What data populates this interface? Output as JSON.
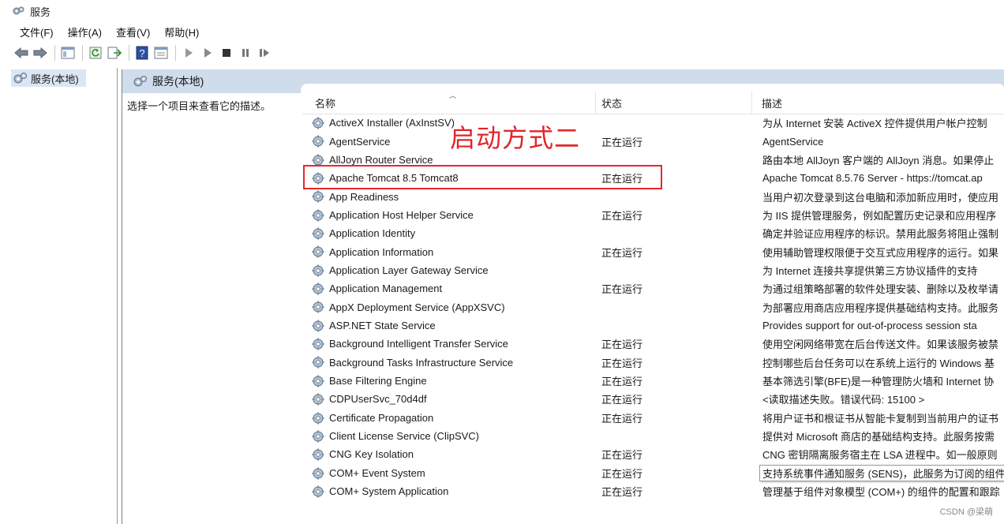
{
  "window": {
    "title": "服务",
    "icon": "services-icon"
  },
  "menu": [
    {
      "label": "文件(F)"
    },
    {
      "label": "操作(A)"
    },
    {
      "label": "查看(V)"
    },
    {
      "label": "帮助(H)"
    }
  ],
  "toolbar": [
    "back-icon",
    "forward-icon",
    "show-hide-tree-icon",
    "refresh-icon",
    "export-list-icon",
    "help-icon",
    "properties-icon",
    "start-service-icon",
    "start-service-alt-icon",
    "stop-service-icon",
    "pause-service-icon",
    "resume-service-icon"
  ],
  "tree": {
    "root_label": "服务(本地)"
  },
  "pane": {
    "header_title": "服务(本地)",
    "select_hint": "选择一个项目来查看它的描述。",
    "columns": {
      "name": "名称",
      "status": "状态",
      "description": "描述"
    }
  },
  "services": [
    {
      "name": "ActiveX Installer (AxInstSV)",
      "status": "",
      "description": "为从 Internet 安装 ActiveX 控件提供用户帐户控制"
    },
    {
      "name": "AgentService",
      "status": "正在运行",
      "description": "AgentService"
    },
    {
      "name": "AllJoyn Router Service",
      "status": "",
      "description": "路由本地 AllJoyn 客户端的 AllJoyn 消息。如果停止"
    },
    {
      "name": "Apache Tomcat 8.5 Tomcat8",
      "status": "正在运行",
      "description": "Apache Tomcat 8.5.76 Server - https://tomcat.ap"
    },
    {
      "name": "App Readiness",
      "status": "",
      "description": "当用户初次登录到这台电脑和添加新应用时，使应用"
    },
    {
      "name": "Application Host Helper Service",
      "status": "正在运行",
      "description": "为 IIS 提供管理服务，例如配置历史记录和应用程序"
    },
    {
      "name": "Application Identity",
      "status": "",
      "description": "确定并验证应用程序的标识。禁用此服务将阻止强制"
    },
    {
      "name": "Application Information",
      "status": "正在运行",
      "description": "使用辅助管理权限便于交互式应用程序的运行。如果"
    },
    {
      "name": "Application Layer Gateway Service",
      "status": "",
      "description": "为 Internet 连接共享提供第三方协议插件的支持"
    },
    {
      "name": "Application Management",
      "status": "正在运行",
      "description": "为通过组策略部署的软件处理安装、删除以及枚举请"
    },
    {
      "name": "AppX Deployment Service (AppXSVC)",
      "status": "",
      "description": "为部署应用商店应用程序提供基础结构支持。此服务"
    },
    {
      "name": "ASP.NET State Service",
      "status": "",
      "description": "Provides support for out-of-process session sta"
    },
    {
      "name": "Background Intelligent Transfer Service",
      "status": "正在运行",
      "description": "使用空闲网络带宽在后台传送文件。如果该服务被禁"
    },
    {
      "name": "Background Tasks Infrastructure Service",
      "status": "正在运行",
      "description": "控制哪些后台任务可以在系统上运行的 Windows 基"
    },
    {
      "name": "Base Filtering Engine",
      "status": "正在运行",
      "description": "基本筛选引擎(BFE)是一种管理防火墙和 Internet 协"
    },
    {
      "name": "CDPUserSvc_70d4df",
      "status": "正在运行",
      "description": "<读取描述失败。错误代码: 15100 >"
    },
    {
      "name": "Certificate Propagation",
      "status": "正在运行",
      "description": "将用户证书和根证书从智能卡复制到当前用户的证书"
    },
    {
      "name": "Client License Service (ClipSVC)",
      "status": "",
      "description": "提供对 Microsoft 商店的基础结构支持。此服务按需"
    },
    {
      "name": "CNG Key Isolation",
      "status": "正在运行",
      "description": "CNG 密钥隔离服务宿主在 LSA 进程中。如一般原则"
    },
    {
      "name": "COM+ Event System",
      "status": "正在运行",
      "description": "支持系统事件通知服务 (SENS)，此服务为订阅的组件"
    },
    {
      "name": "COM+ System Application",
      "status": "正在运行",
      "description": "管理基于组件对象模型 (COM+) 的组件的配置和跟踪"
    }
  ],
  "annotation": {
    "text": "启动方式二",
    "color": "#e0262b"
  },
  "watermark": "CSDN @梁萌",
  "colors": {
    "header_bg": "#cfdcec",
    "selection_bg": "#dbe6f4",
    "highlight_border": "#e8262b"
  }
}
